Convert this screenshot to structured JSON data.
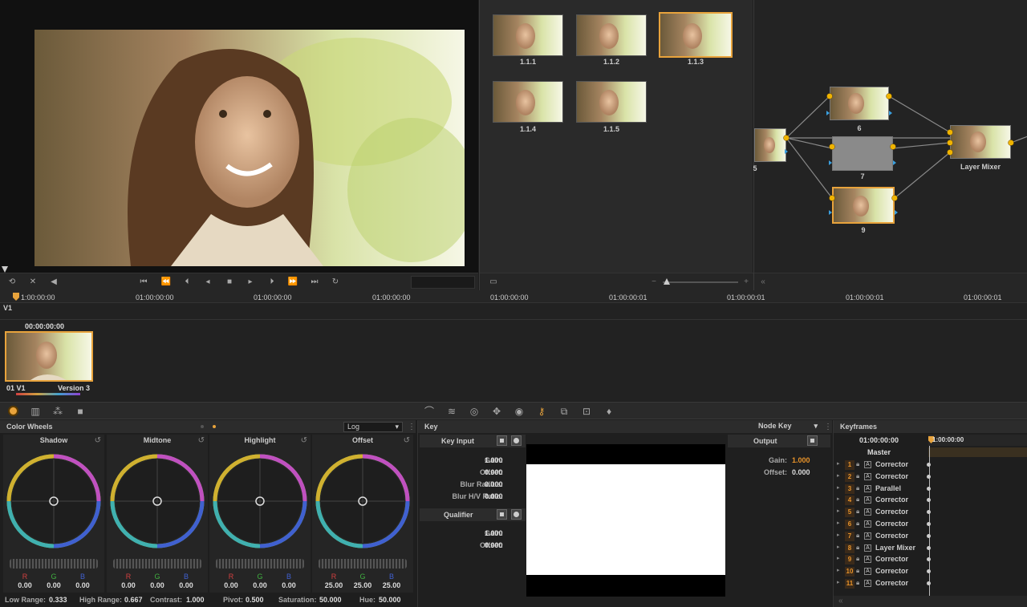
{
  "gallery": {
    "stills": [
      "1.1.1",
      "1.1.2",
      "1.1.3",
      "1.1.4",
      "1.1.5"
    ],
    "selected": "1.1.3"
  },
  "nodes": {
    "labels": [
      "5",
      "6",
      "7",
      "9",
      "Layer Mixer"
    ]
  },
  "timeline": {
    "start_tc": "1:00:00:00",
    "ruler": [
      "01:00:00:00",
      "01:00:00:00",
      "01:00:00:00",
      "01:00:00:00",
      "01:00:00:01",
      "01:00:00:01",
      "01:00:00:01",
      "01:00:00:01"
    ],
    "track": "V1",
    "clip_tc": "00:00:00:00",
    "clip_name": "01 V1",
    "clip_version": "Version 3"
  },
  "color_wheels": {
    "title": "Color Wheels",
    "mode": "Log",
    "wheels": [
      {
        "name": "Shadow",
        "r": "0.00",
        "g": "0.00",
        "b": "0.00"
      },
      {
        "name": "Midtone",
        "r": "0.00",
        "g": "0.00",
        "b": "0.00"
      },
      {
        "name": "Highlight",
        "r": "0.00",
        "g": "0.00",
        "b": "0.00"
      },
      {
        "name": "Offset",
        "r": "25.00",
        "g": "25.00",
        "b": "25.00"
      }
    ],
    "rgb_labels": [
      "R",
      "G",
      "B"
    ],
    "footer": {
      "low_range_label": "Low Range:",
      "low_range": "0.333",
      "high_range_label": "High Range:",
      "high_range": "0.667",
      "contrast_label": "Contrast:",
      "contrast": "1.000",
      "pivot_label": "Pivot:",
      "pivot": "0.500",
      "saturation_label": "Saturation:",
      "saturation": "50.000",
      "hue_label": "Hue:",
      "hue": "50.000"
    }
  },
  "key": {
    "title": "Key",
    "mode": "Node Key",
    "key_input": "Key Input",
    "output": "Output",
    "qualifier": "Qualifier",
    "input_fields": [
      {
        "label": "Gain:",
        "value": "1.000"
      },
      {
        "label": "Offset:",
        "value": "0.000"
      },
      {
        "label": "Blur Radius:",
        "value": "0.000"
      },
      {
        "label": "Blur H/V Ratio:",
        "value": "0.000"
      }
    ],
    "output_fields": [
      {
        "label": "Gain:",
        "value": "1.000"
      },
      {
        "label": "Offset:",
        "value": "0.000"
      }
    ],
    "qualifier_fields": [
      {
        "label": "Gain:",
        "value": "1.000"
      },
      {
        "label": "Offset:",
        "value": "0.000"
      }
    ]
  },
  "keyframes": {
    "title": "Keyframes",
    "tc": "01:00:00:00",
    "ruler_tc": "1:00:00:00",
    "master": "Master",
    "rows": [
      {
        "num": "1",
        "name": "Corrector"
      },
      {
        "num": "2",
        "name": "Corrector"
      },
      {
        "num": "3",
        "name": "Parallel"
      },
      {
        "num": "4",
        "name": "Corrector"
      },
      {
        "num": "5",
        "name": "Corrector"
      },
      {
        "num": "6",
        "name": "Corrector"
      },
      {
        "num": "7",
        "name": "Corrector"
      },
      {
        "num": "8",
        "name": "Layer Mixer"
      },
      {
        "num": "9",
        "name": "Corrector"
      },
      {
        "num": "10",
        "name": "Corrector"
      },
      {
        "num": "11",
        "name": "Corrector"
      }
    ]
  },
  "colors": {
    "accent": "#e8a33c",
    "bg": "#1e1e1e"
  }
}
